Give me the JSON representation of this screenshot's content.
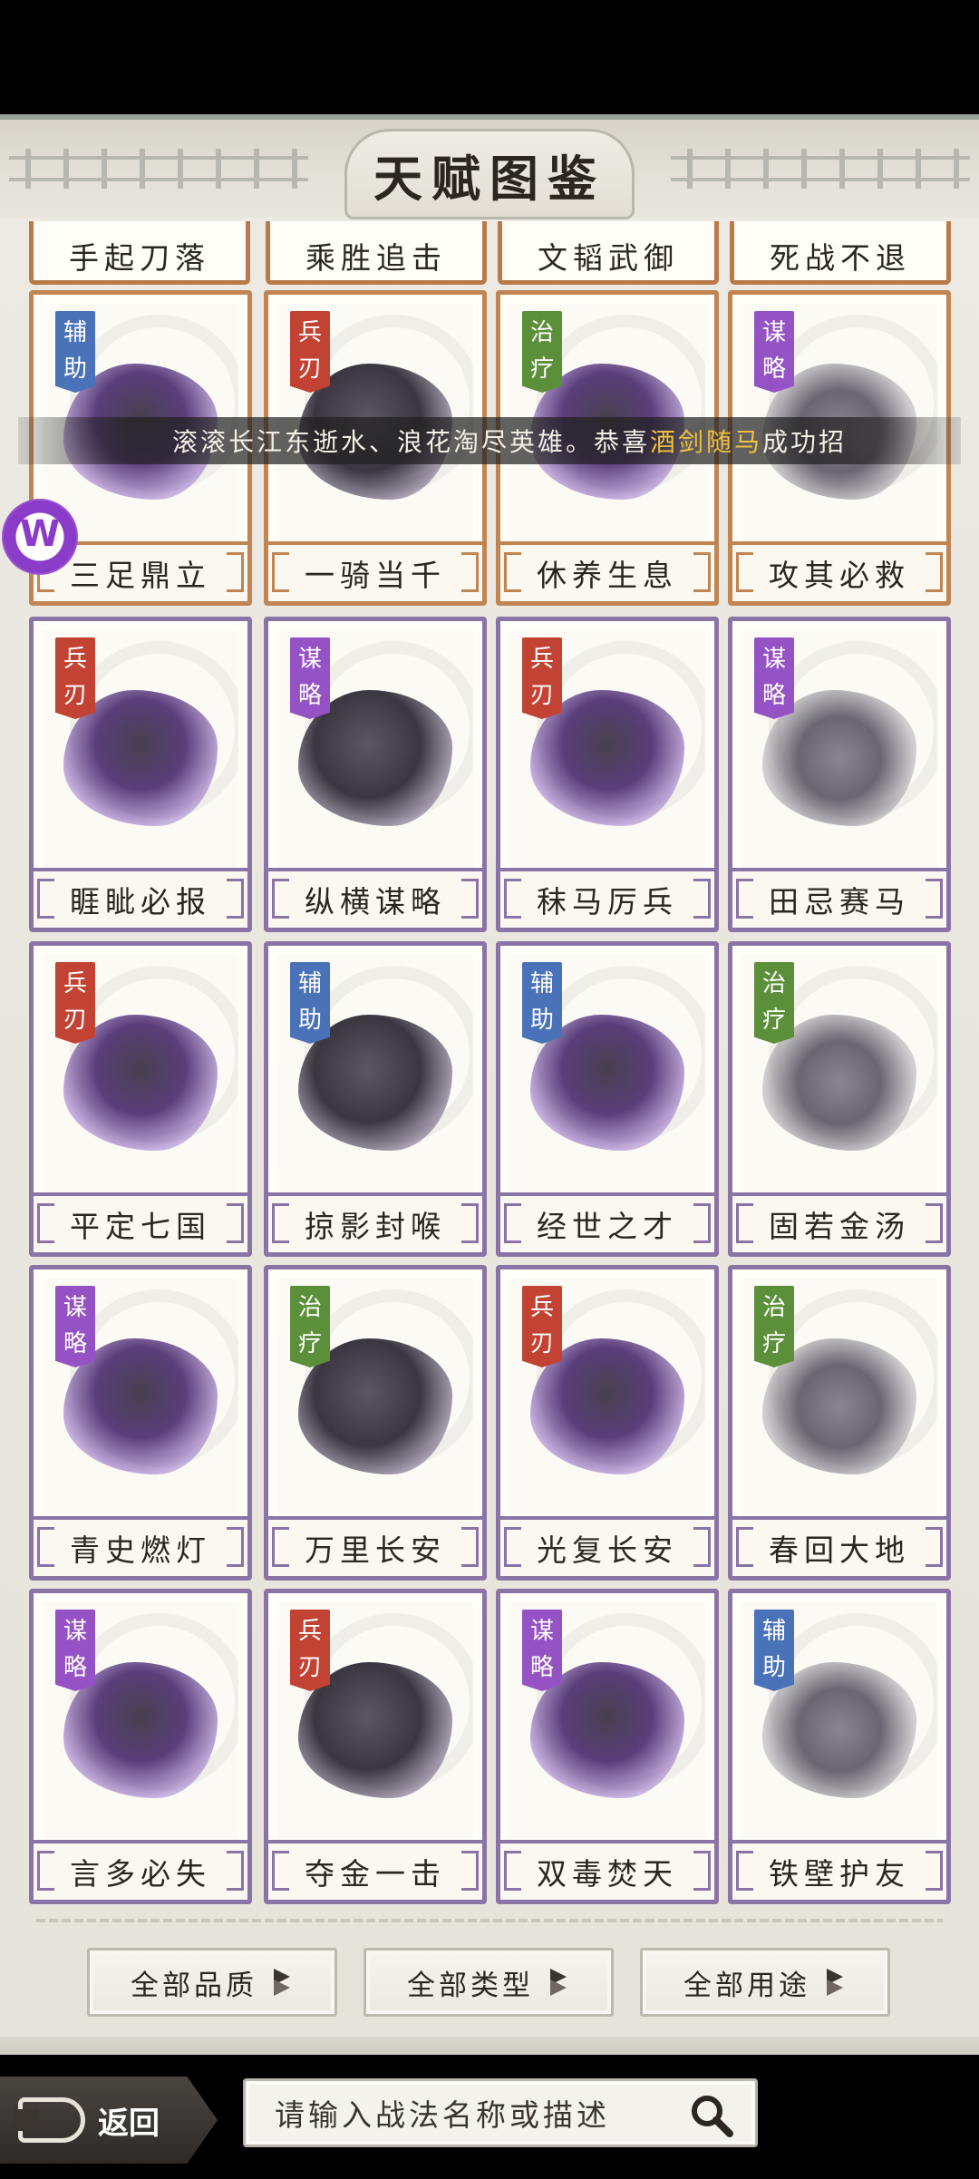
{
  "header": {
    "title": "天赋图鉴"
  },
  "partial_row": [
    "手起刀落",
    "乘胜追击",
    "文韬武御",
    "死战不退"
  ],
  "ticker": {
    "prefix": "滚滚长江东逝水、浪花淘尽英雄。恭喜",
    "highlight": "酒剑随马",
    "suffix": "成功招"
  },
  "logo_letter": "W",
  "cards": [
    {
      "name": "三足鼎立",
      "tag": "辅助",
      "tag_type": "fu",
      "frame": "orange",
      "art": "ding-icon"
    },
    {
      "name": "一骑当千",
      "tag": "兵刃",
      "tag_type": "bing",
      "frame": "orange",
      "art": "cavalry-icon"
    },
    {
      "name": "休养生息",
      "tag": "治疗",
      "tag_type": "zhi",
      "frame": "orange",
      "art": "meditation-icon"
    },
    {
      "name": "攻其必救",
      "tag": "谋略",
      "tag_type": "mou",
      "frame": "orange",
      "art": "warrior-icon"
    },
    {
      "name": "睚眦必报",
      "tag": "兵刃",
      "tag_type": "bing",
      "frame": "purple",
      "art": "swordsman-icon"
    },
    {
      "name": "纵横谋略",
      "tag": "谋略",
      "tag_type": "mou",
      "frame": "purple",
      "art": "strategist-icon"
    },
    {
      "name": "秣马厉兵",
      "tag": "兵刃",
      "tag_type": "bing",
      "frame": "purple",
      "art": "spearman-icon"
    },
    {
      "name": "田忌赛马",
      "tag": "谋略",
      "tag_type": "mou",
      "frame": "purple",
      "art": "horses-icon"
    },
    {
      "name": "平定七国",
      "tag": "兵刃",
      "tag_type": "bing",
      "frame": "purple",
      "art": "general-icon"
    },
    {
      "name": "掠影封喉",
      "tag": "辅助",
      "tag_type": "fu",
      "frame": "purple",
      "art": "assassin-icon"
    },
    {
      "name": "经世之才",
      "tag": "辅助",
      "tag_type": "fu",
      "frame": "purple",
      "art": "scholar-icon"
    },
    {
      "name": "固若金汤",
      "tag": "治疗",
      "tag_type": "zhi",
      "frame": "purple",
      "art": "fortress-icon"
    },
    {
      "name": "青史燃灯",
      "tag": "谋略",
      "tag_type": "mou",
      "frame": "purple",
      "art": "writer-icon"
    },
    {
      "name": "万里长安",
      "tag": "治疗",
      "tag_type": "zhi",
      "frame": "purple",
      "art": "city-icon"
    },
    {
      "name": "光复长安",
      "tag": "兵刃",
      "tag_type": "bing",
      "frame": "purple",
      "art": "banner-army-icon"
    },
    {
      "name": "春回大地",
      "tag": "治疗",
      "tag_type": "zhi",
      "frame": "purple",
      "art": "landscape-icon"
    },
    {
      "name": "言多必失",
      "tag": "谋略",
      "tag_type": "mou",
      "frame": "purple",
      "art": "sage-icon"
    },
    {
      "name": "夺金一击",
      "tag": "兵刃",
      "tag_type": "bing",
      "frame": "purple",
      "art": "lunge-icon"
    },
    {
      "name": "双毒焚天",
      "tag": "谋略",
      "tag_type": "mou",
      "frame": "purple",
      "art": "poison-icon"
    },
    {
      "name": "铁壁护友",
      "tag": "辅助",
      "tag_type": "fu",
      "frame": "purple",
      "art": "shield-icon"
    }
  ],
  "filters": [
    {
      "label": "全部品质"
    },
    {
      "label": "全部类型"
    },
    {
      "label": "全部用途"
    }
  ],
  "footer": {
    "back_label": "返回",
    "search_placeholder": "请输入战法名称或描述"
  },
  "colors": {
    "tag_fu": "#4a72b8",
    "tag_bing": "#c24333",
    "tag_zhi": "#5c8f3a",
    "tag_mou": "#9552c4",
    "frame_orange": "#c08553",
    "frame_purple": "#8a74a6",
    "ticker_highlight": "#f0c040"
  }
}
